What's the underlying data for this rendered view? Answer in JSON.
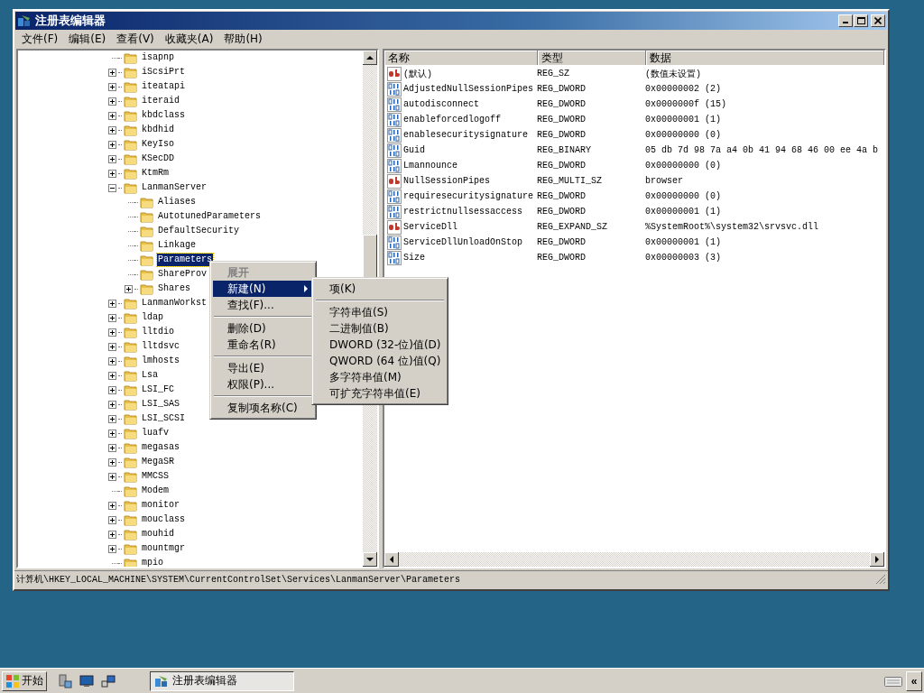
{
  "window": {
    "title": "注册表编辑器"
  },
  "menu_bar": [
    "文件(F)",
    "编辑(E)",
    "查看(V)",
    "收藏夹(A)",
    "帮助(H)"
  ],
  "tree": [
    {
      "label": "isapnp",
      "kind": "leaf",
      "selected": false
    },
    {
      "label": "iScsiPrt",
      "kind": "collapsed",
      "selected": false
    },
    {
      "label": "iteatapi",
      "kind": "collapsed",
      "selected": false
    },
    {
      "label": "iteraid",
      "kind": "collapsed",
      "selected": false
    },
    {
      "label": "kbdclass",
      "kind": "collapsed",
      "selected": false
    },
    {
      "label": "kbdhid",
      "kind": "collapsed",
      "selected": false
    },
    {
      "label": "KeyIso",
      "kind": "collapsed",
      "selected": false
    },
    {
      "label": "KSecDD",
      "kind": "collapsed",
      "selected": false
    },
    {
      "label": "KtmRm",
      "kind": "collapsed",
      "selected": false
    },
    {
      "label": "LanmanServer",
      "kind": "expanded",
      "selected": false,
      "children": [
        {
          "label": "Aliases",
          "kind": "leaf",
          "selected": false
        },
        {
          "label": "AutotunedParameters",
          "kind": "leaf",
          "selected": false
        },
        {
          "label": "DefaultSecurity",
          "kind": "leaf",
          "selected": false
        },
        {
          "label": "Linkage",
          "kind": "leaf",
          "selected": false
        },
        {
          "label": "Parameters",
          "kind": "leaf",
          "selected": true
        },
        {
          "label": "ShareProv",
          "kind": "leaf",
          "selected": false
        },
        {
          "label": "Shares",
          "kind": "collapsed",
          "selected": false
        }
      ]
    },
    {
      "label": "LanmanWorkst",
      "kind": "collapsed",
      "selected": false
    },
    {
      "label": "ldap",
      "kind": "collapsed",
      "selected": false
    },
    {
      "label": "lltdio",
      "kind": "collapsed",
      "selected": false
    },
    {
      "label": "lltdsvc",
      "kind": "collapsed",
      "selected": false
    },
    {
      "label": "lmhosts",
      "kind": "collapsed",
      "selected": false
    },
    {
      "label": "Lsa",
      "kind": "collapsed",
      "selected": false
    },
    {
      "label": "LSI_FC",
      "kind": "collapsed",
      "selected": false
    },
    {
      "label": "LSI_SAS",
      "kind": "collapsed",
      "selected": false
    },
    {
      "label": "LSI_SCSI",
      "kind": "collapsed",
      "selected": false
    },
    {
      "label": "luafv",
      "kind": "collapsed",
      "selected": false
    },
    {
      "label": "megasas",
      "kind": "collapsed",
      "selected": false
    },
    {
      "label": "MegaSR",
      "kind": "collapsed",
      "selected": false
    },
    {
      "label": "MMCSS",
      "kind": "collapsed",
      "selected": false
    },
    {
      "label": "Modem",
      "kind": "leaf",
      "selected": false
    },
    {
      "label": "monitor",
      "kind": "collapsed",
      "selected": false
    },
    {
      "label": "mouclass",
      "kind": "collapsed",
      "selected": false
    },
    {
      "label": "mouhid",
      "kind": "collapsed",
      "selected": false
    },
    {
      "label": "mountmgr",
      "kind": "collapsed",
      "selected": false
    },
    {
      "label": "mpio",
      "kind": "leaf",
      "selected": false
    }
  ],
  "values": {
    "columns": [
      "名称",
      "类型",
      "数据"
    ],
    "rows": [
      {
        "kind": "string",
        "name": "(默认)",
        "type": "REG_SZ",
        "data": "(数值未设置)"
      },
      {
        "kind": "binary",
        "name": "AdjustedNullSessionPipes",
        "type": "REG_DWORD",
        "data": "0x00000002 (2)"
      },
      {
        "kind": "binary",
        "name": "autodisconnect",
        "type": "REG_DWORD",
        "data": "0x0000000f (15)"
      },
      {
        "kind": "binary",
        "name": "enableforcedlogoff",
        "type": "REG_DWORD",
        "data": "0x00000001 (1)"
      },
      {
        "kind": "binary",
        "name": "enablesecuritysignature",
        "type": "REG_DWORD",
        "data": "0x00000000 (0)"
      },
      {
        "kind": "binary",
        "name": "Guid",
        "type": "REG_BINARY",
        "data": "05 db 7d 98 7a a4 0b 41 94 68 46 00 ee 4a b"
      },
      {
        "kind": "binary",
        "name": "Lmannounce",
        "type": "REG_DWORD",
        "data": "0x00000000 (0)"
      },
      {
        "kind": "string",
        "name": "NullSessionPipes",
        "type": "REG_MULTI_SZ",
        "data": "browser"
      },
      {
        "kind": "binary",
        "name": "requiresecuritysignature",
        "type": "REG_DWORD",
        "data": "0x00000000 (0)"
      },
      {
        "kind": "binary",
        "name": "restrictnullsessaccess",
        "type": "REG_DWORD",
        "data": "0x00000001 (1)"
      },
      {
        "kind": "string",
        "name": "ServiceDll",
        "type": "REG_EXPAND_SZ",
        "data": "%SystemRoot%\\system32\\srvsvc.dll"
      },
      {
        "kind": "binary",
        "name": "ServiceDllUnloadOnStop",
        "type": "REG_DWORD",
        "data": "0x00000001 (1)"
      },
      {
        "kind": "binary",
        "name": "Size",
        "type": "REG_DWORD",
        "data": "0x00000003 (3)"
      }
    ]
  },
  "context_menu": [
    {
      "kind": "item",
      "label": "展开",
      "disabled": true,
      "selected": false,
      "submenu": false
    },
    {
      "kind": "item",
      "label": "新建(N)",
      "disabled": false,
      "selected": true,
      "submenu": true
    },
    {
      "kind": "item",
      "label": "查找(F)...",
      "disabled": false,
      "selected": false,
      "submenu": false
    },
    {
      "kind": "separator"
    },
    {
      "kind": "item",
      "label": "删除(D)",
      "disabled": false,
      "selected": false,
      "submenu": false
    },
    {
      "kind": "item",
      "label": "重命名(R)",
      "disabled": false,
      "selected": false,
      "submenu": false
    },
    {
      "kind": "separator"
    },
    {
      "kind": "item",
      "label": "导出(E)",
      "disabled": false,
      "selected": false,
      "submenu": false
    },
    {
      "kind": "item",
      "label": "权限(P)...",
      "disabled": false,
      "selected": false,
      "submenu": false
    },
    {
      "kind": "separator"
    },
    {
      "kind": "item",
      "label": "复制项名称(C)",
      "disabled": false,
      "selected": false,
      "submenu": false
    }
  ],
  "submenu": [
    {
      "kind": "item",
      "label": "项(K)",
      "disabled": false,
      "selected": false,
      "submenu": false
    },
    {
      "kind": "separator"
    },
    {
      "kind": "item",
      "label": "字符串值(S)",
      "disabled": false,
      "selected": false,
      "submenu": false
    },
    {
      "kind": "item",
      "label": "二进制值(B)",
      "disabled": false,
      "selected": false,
      "submenu": false
    },
    {
      "kind": "item",
      "label": "DWORD (32-位)值(D)",
      "disabled": false,
      "selected": false,
      "submenu": false
    },
    {
      "kind": "item",
      "label": "QWORD (64 位)值(Q)",
      "disabled": false,
      "selected": false,
      "submenu": false
    },
    {
      "kind": "item",
      "label": "多字符串值(M)",
      "disabled": false,
      "selected": false,
      "submenu": false
    },
    {
      "kind": "item",
      "label": "可扩充字符串值(E)",
      "disabled": false,
      "selected": false,
      "submenu": false
    }
  ],
  "status_bar": "计算机\\HKEY_LOCAL_MACHINE\\SYSTEM\\CurrentControlSet\\Services\\LanmanServer\\Parameters",
  "taskbar": {
    "start": "开始",
    "tasks": [
      {
        "label": "注册表编辑器",
        "selected": true
      }
    ],
    "tray_button": "«"
  }
}
